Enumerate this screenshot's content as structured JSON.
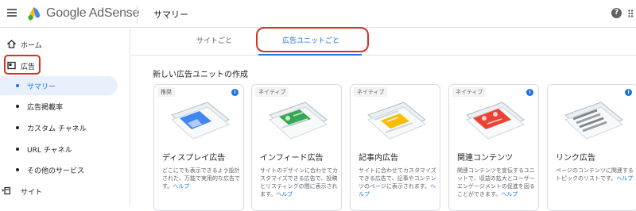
{
  "app": {
    "brand": "Google AdSense",
    "page_title": "サマリー",
    "help_label": "?"
  },
  "sidebar": {
    "items": [
      {
        "label": "ホーム",
        "icon": "home-icon"
      },
      {
        "label": "広告",
        "icon": "ads-icon"
      },
      {
        "label": "サマリー"
      },
      {
        "label": "広告掲載率"
      },
      {
        "label": "カスタム チャネル"
      },
      {
        "label": "URL チャネル"
      },
      {
        "label": "その他のサービス"
      },
      {
        "label": "サイト",
        "icon": "sites-icon"
      }
    ]
  },
  "tabs": [
    {
      "label": "サイトごと"
    },
    {
      "label": "広告ユニットごと"
    }
  ],
  "section_title": "新しい広告ユニットの作成",
  "cards": [
    {
      "badge": "推奨",
      "info": "i",
      "title": "ディスプレイ広告",
      "desc": "どこにでも表示できるよう設計された、万能で実用的な広告です。",
      "link": "ヘルプ",
      "accent": "#4285f4"
    },
    {
      "badge": "ネイティブ",
      "info": "",
      "title": "インフィード広告",
      "desc": "サイトのデザインに合わせてカスタマイズできる広告で、投稿とリスティングの間に表示されます。",
      "link": "ヘルプ",
      "accent": "#34a853"
    },
    {
      "badge": "ネイティブ",
      "info": "",
      "title": "記事内広告",
      "desc": "サイトに合わせてカスタマイズできる広告で、記事やコンテンツのページに表示されます。",
      "link": "ヘルプ",
      "accent": "#fbbc04"
    },
    {
      "badge": "ネイティブ",
      "info": "i",
      "title": "関連コンテンツ",
      "desc": "関連コンテンツを宣伝するユニットで、収益の拡大とユーザー エンゲージメントの促進を図ることができます。",
      "link": "ヘルプ",
      "accent": "#ea4335"
    },
    {
      "badge": "",
      "info": "i",
      "title": "リンク広告",
      "desc": "ページのコンテンツに関連するトピックのリストです。",
      "link": "ヘルプ",
      "accent": "#9aa0a6"
    }
  ]
}
